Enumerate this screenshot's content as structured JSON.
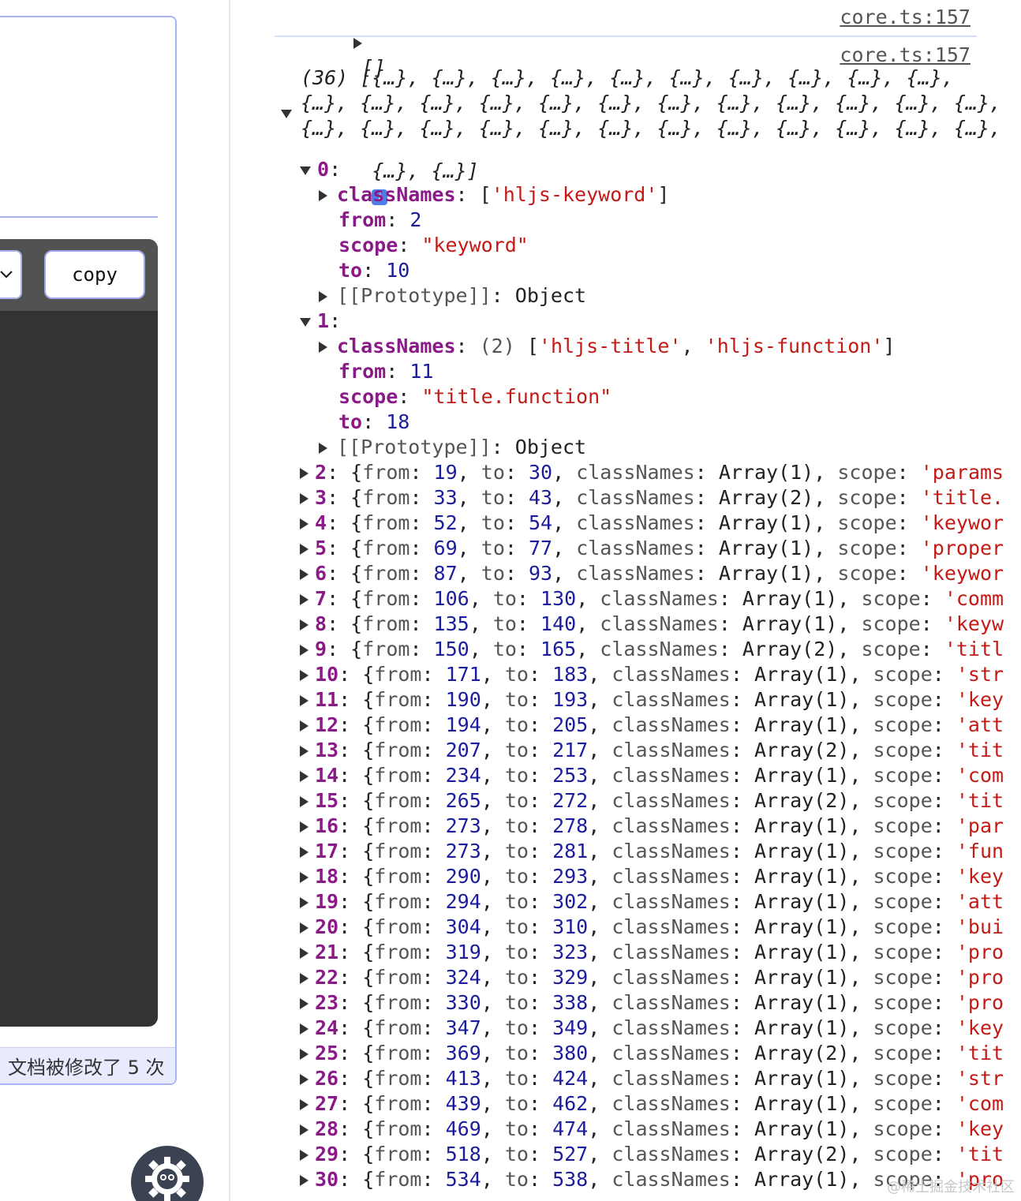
{
  "editor": {
    "copy_label": "copy",
    "status_text": "文档被修改了 5 次"
  },
  "console": {
    "log1": {
      "text": "[]",
      "source": "core.ts:157"
    },
    "log2": {
      "source": "core.ts:157",
      "summary_lines": [
        "(36) [{…}, {…}, {…}, {…}, {…}, {…}, {…}, {…}, {…}, {…},",
        "{…}, {…}, {…}, {…}, {…}, {…}, {…}, {…}, {…}, {…}, {…}, {…},",
        "{…}, {…}, {…}, {…}, {…}, {…}, {…}, {…}, {…}, {…}, {…}, {…},",
        "{…}, {…}]"
      ],
      "expanded": [
        {
          "index": "0",
          "classNames_count": "",
          "classNames": "['hljs-keyword']",
          "from": "2",
          "scope": "\"keyword\"",
          "to": "10",
          "prototype": "Object"
        },
        {
          "index": "1",
          "classNames_count": "(2)",
          "classNames": "['hljs-title', 'hljs-function']",
          "from": "11",
          "scope": "\"title.function\"",
          "to": "18",
          "prototype": "Object"
        }
      ],
      "collapsed": [
        {
          "index": "2",
          "from": "19",
          "to": "30",
          "arr": "Array(1)",
          "scope": "'params"
        },
        {
          "index": "3",
          "from": "33",
          "to": "43",
          "arr": "Array(2)",
          "scope": "'title."
        },
        {
          "index": "4",
          "from": "52",
          "to": "54",
          "arr": "Array(1)",
          "scope": "'keywor"
        },
        {
          "index": "5",
          "from": "69",
          "to": "77",
          "arr": "Array(1)",
          "scope": "'proper"
        },
        {
          "index": "6",
          "from": "87",
          "to": "93",
          "arr": "Array(1)",
          "scope": "'keywor"
        },
        {
          "index": "7",
          "from": "106",
          "to": "130",
          "arr": "Array(1)",
          "scope": "'comm"
        },
        {
          "index": "8",
          "from": "135",
          "to": "140",
          "arr": "Array(1)",
          "scope": "'keyw"
        },
        {
          "index": "9",
          "from": "150",
          "to": "165",
          "arr": "Array(2)",
          "scope": "'titl"
        },
        {
          "index": "10",
          "from": "171",
          "to": "183",
          "arr": "Array(1)",
          "scope": "'str"
        },
        {
          "index": "11",
          "from": "190",
          "to": "193",
          "arr": "Array(1)",
          "scope": "'key"
        },
        {
          "index": "12",
          "from": "194",
          "to": "205",
          "arr": "Array(1)",
          "scope": "'att"
        },
        {
          "index": "13",
          "from": "207",
          "to": "217",
          "arr": "Array(2)",
          "scope": "'tit"
        },
        {
          "index": "14",
          "from": "234",
          "to": "253",
          "arr": "Array(1)",
          "scope": "'com"
        },
        {
          "index": "15",
          "from": "265",
          "to": "272",
          "arr": "Array(2)",
          "scope": "'tit"
        },
        {
          "index": "16",
          "from": "273",
          "to": "278",
          "arr": "Array(1)",
          "scope": "'par"
        },
        {
          "index": "17",
          "from": "273",
          "to": "281",
          "arr": "Array(1)",
          "scope": "'fun"
        },
        {
          "index": "18",
          "from": "290",
          "to": "293",
          "arr": "Array(1)",
          "scope": "'key"
        },
        {
          "index": "19",
          "from": "294",
          "to": "302",
          "arr": "Array(1)",
          "scope": "'att"
        },
        {
          "index": "20",
          "from": "304",
          "to": "310",
          "arr": "Array(1)",
          "scope": "'bui"
        },
        {
          "index": "21",
          "from": "319",
          "to": "323",
          "arr": "Array(1)",
          "scope": "'pro"
        },
        {
          "index": "22",
          "from": "324",
          "to": "329",
          "arr": "Array(1)",
          "scope": "'pro"
        },
        {
          "index": "23",
          "from": "330",
          "to": "338",
          "arr": "Array(1)",
          "scope": "'pro"
        },
        {
          "index": "24",
          "from": "347",
          "to": "349",
          "arr": "Array(1)",
          "scope": "'key"
        },
        {
          "index": "25",
          "from": "369",
          "to": "380",
          "arr": "Array(2)",
          "scope": "'tit"
        },
        {
          "index": "26",
          "from": "413",
          "to": "424",
          "arr": "Array(1)",
          "scope": "'str"
        },
        {
          "index": "27",
          "from": "439",
          "to": "462",
          "arr": "Array(1)",
          "scope": "'com"
        },
        {
          "index": "28",
          "from": "469",
          "to": "474",
          "arr": "Array(1)",
          "scope": "'key"
        },
        {
          "index": "29",
          "from": "518",
          "to": "527",
          "arr": "Array(2)",
          "scope": "'tit"
        },
        {
          "index": "30",
          "from": "534",
          "to": "538",
          "arr": "Array(1)",
          "scope": "'pro"
        }
      ],
      "labels": {
        "classNames": "classNames",
        "from": "from",
        "scope": "scope",
        "to": "to",
        "prototype_key": "[[Prototype]]"
      }
    }
  },
  "watermark": "@稀土掘金技术社区"
}
